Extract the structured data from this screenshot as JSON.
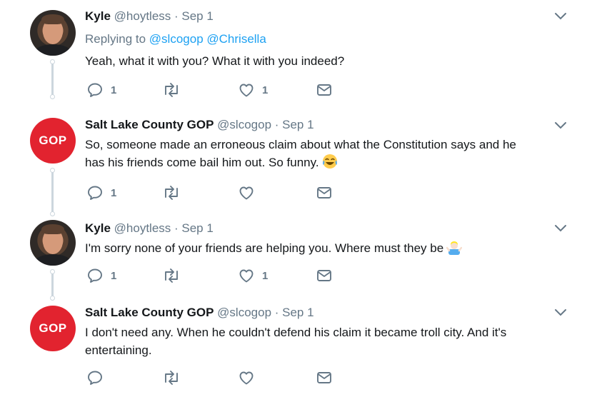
{
  "tweets": [
    {
      "name": "Kyle",
      "handle": "@hoytless",
      "date": "Sep 1",
      "reply_prefix": "Replying to",
      "reply_to": [
        "@slcogop",
        "@Chrisella"
      ],
      "text": "Yeah, what it with you? What it with you indeed?",
      "replies": "1",
      "likes": "1"
    },
    {
      "name": "Salt Lake County GOP",
      "handle": "@slcogop",
      "date": "Sep 1",
      "avatar_text": "GOP",
      "text_line1": "So, someone made an erroneous claim about what the Constitution says and he",
      "text_line2": "has his friends come bail him out. So funny.",
      "emoji": "face-with-tears-of-joy",
      "replies": "1",
      "likes": ""
    },
    {
      "name": "Kyle",
      "handle": "@hoytless",
      "date": "Sep 1",
      "text": "I'm sorry none of your friends are helping you. Where must they be",
      "emoji": "man-shrugging",
      "replies": "1",
      "likes": "1"
    },
    {
      "name": "Salt Lake County GOP",
      "handle": "@slcogop",
      "date": "Sep 1",
      "avatar_text": "GOP",
      "text_line1": "I don't need any. When he couldn't defend his claim it became troll city. And it's",
      "text_line2": "entertaining.",
      "replies": "",
      "likes": ""
    }
  ],
  "separator": " · ",
  "colors": {
    "accent": "#1da1f2",
    "muted": "#657786",
    "gop_red": "#e2232f",
    "line": "#ccd6dd"
  }
}
